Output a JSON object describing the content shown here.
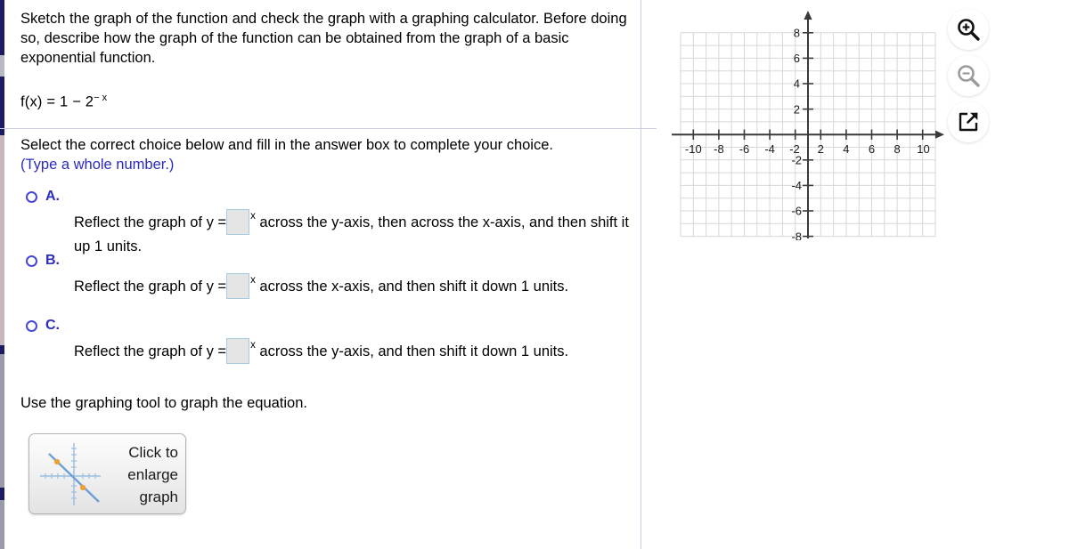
{
  "question": {
    "prompt": "Sketch the graph of the function and check the graph with a graphing calculator. Before doing so, describe how the graph of the function can be obtained from the graph of a basic exponential function.",
    "equation_main": "f(x) = 1 − 2",
    "equation_exponent": "− x"
  },
  "instruction": {
    "line1": "Select the correct choice below and fill in the answer box to complete your choice.",
    "line2": "(Type a whole number.)"
  },
  "choices": [
    {
      "letter": "A.",
      "text_before": "Reflect the graph of y =",
      "box_value": "",
      "exponent": "x",
      "text_after": "across the y-axis, then across the x-axis, and then shift it up 1 units.",
      "selected": false
    },
    {
      "letter": "B.",
      "text_before": "Reflect the graph of y =",
      "box_value": "",
      "exponent": "x",
      "text_after": "across the x-axis, and then shift it down 1 units.",
      "selected": false
    },
    {
      "letter": "C.",
      "text_before": "Reflect the graph of y =",
      "box_value": "",
      "exponent": "x",
      "text_after": "across the y-axis, and then shift it down 1 units.",
      "selected": false
    }
  ],
  "graphing_tool": {
    "instruction": "Use the graphing tool to graph the equation.",
    "button_label": "Click to enlarge graph"
  },
  "toolbar": {
    "buttons": [
      {
        "name": "zoom-in-icon",
        "enabled": true
      },
      {
        "name": "zoom-out-icon",
        "enabled": false
      },
      {
        "name": "expand-icon",
        "enabled": true
      }
    ]
  },
  "chart_data": {
    "type": "scatter",
    "title": "",
    "xlabel": "",
    "ylabel": "",
    "xlim": [
      -10,
      10
    ],
    "ylim": [
      -8,
      8
    ],
    "x_ticks": [
      -10,
      -8,
      -6,
      -4,
      -2,
      2,
      4,
      6,
      8,
      10
    ],
    "y_ticks": [
      8,
      6,
      4,
      2,
      -2,
      -4,
      -6,
      -8
    ],
    "x_tick_labels": [
      "-10",
      "-8",
      "-6",
      "-4",
      "-2",
      "2",
      "4",
      "6",
      "8",
      "10"
    ],
    "y_tick_labels": [
      "8",
      "6",
      "4",
      "2",
      "-2",
      "-4",
      "-6",
      "-8"
    ],
    "grid": true,
    "grid_step": 1,
    "legend": "none",
    "series": [],
    "values": [],
    "note": "empty coordinate plane; no curve plotted"
  },
  "colors": {
    "accent_blue": "#2b2bbd",
    "radio_blue": "#4646d8",
    "divider": "#c9cede",
    "grid": "#d2d2d2",
    "axis": "#3a3a3a",
    "answer_box_fill": "#e5e5e5",
    "answer_box_border": "#a9c9dd",
    "thumb_line": "#6f9fd8",
    "thumb_point": "#f0a030"
  }
}
